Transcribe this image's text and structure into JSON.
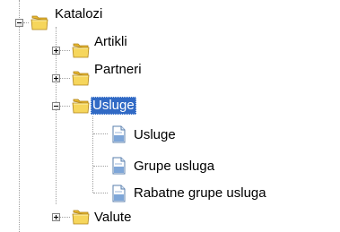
{
  "tree": {
    "items": [
      {
        "label": "Katalozi",
        "icon": "folder-icon",
        "expanded": true,
        "selected": false
      },
      {
        "label": "Artikli",
        "icon": "folder-icon",
        "expanded": false,
        "selected": false
      },
      {
        "label": "Partneri",
        "icon": "folder-icon",
        "expanded": false,
        "selected": false
      },
      {
        "label": "Usluge",
        "icon": "folder-icon",
        "expanded": true,
        "selected": true
      },
      {
        "label": "Usluge",
        "icon": "document-icon",
        "selected": false
      },
      {
        "label": "Grupe usluga",
        "icon": "document-icon",
        "selected": false
      },
      {
        "label": "Rabatne grupe usluga",
        "icon": "document-icon",
        "selected": false
      },
      {
        "label": "Valute",
        "icon": "folder-icon",
        "expanded": false,
        "selected": false
      }
    ]
  },
  "colors": {
    "selection_background": "#316ac5",
    "selection_text": "#ffffff",
    "folder_yellow": "#f6d65c",
    "document_blue": "#7ea6d8",
    "tree_lines": "#a0a0a0"
  }
}
